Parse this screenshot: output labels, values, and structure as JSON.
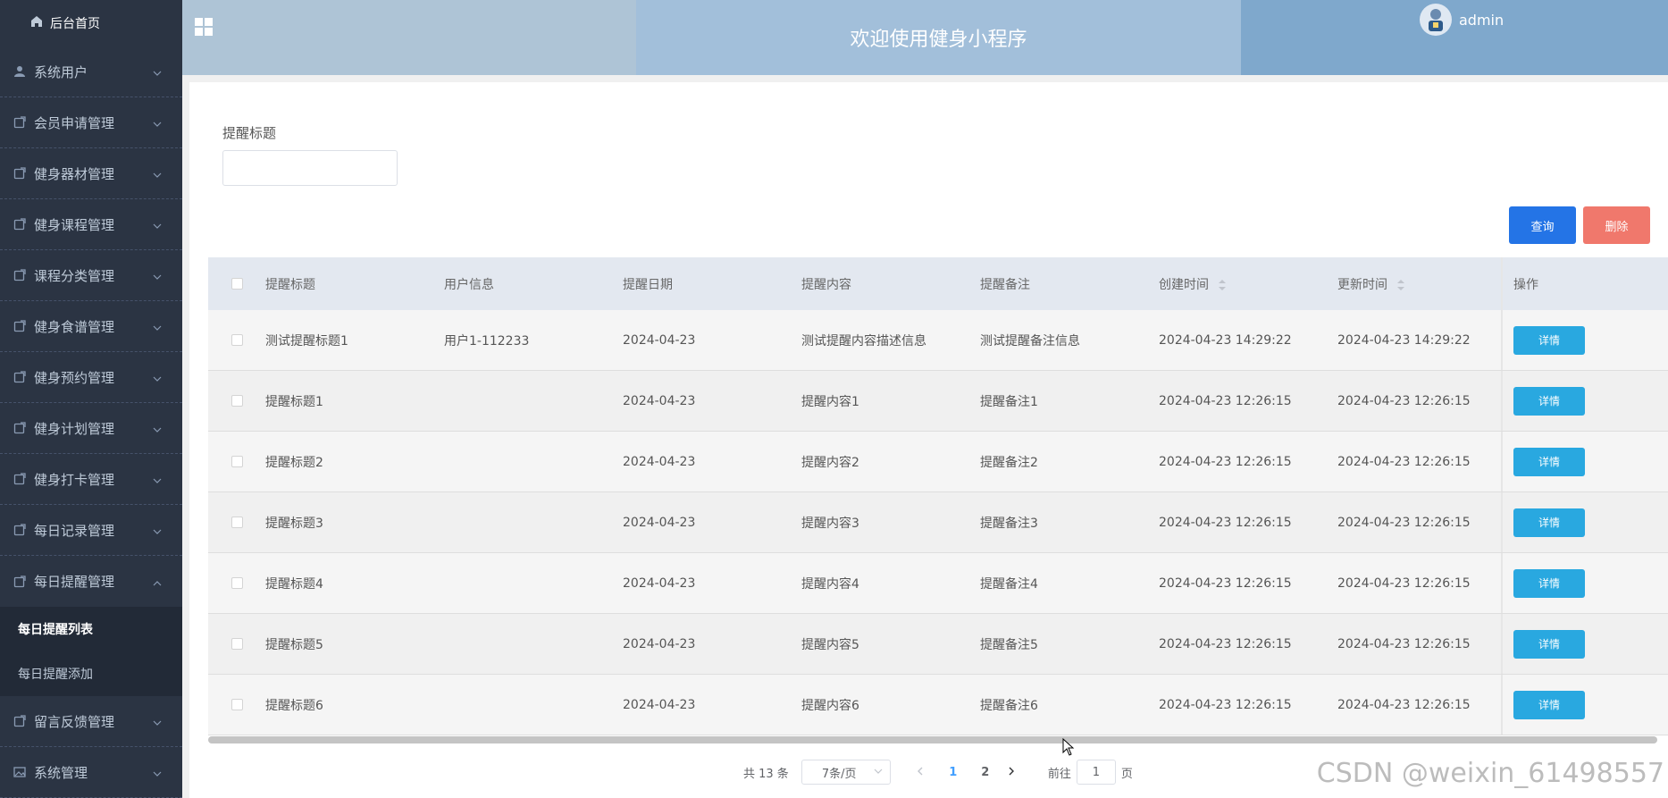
{
  "sidebar": {
    "home_label": "后台首页",
    "items": [
      {
        "label": "系统用户",
        "icon": "user-icon"
      },
      {
        "label": "会员申请管理",
        "icon": "doc-icon"
      },
      {
        "label": "健身器材管理",
        "icon": "doc-icon"
      },
      {
        "label": "健身课程管理",
        "icon": "doc-icon"
      },
      {
        "label": "课程分类管理",
        "icon": "doc-icon"
      },
      {
        "label": "健身食谱管理",
        "icon": "doc-icon"
      },
      {
        "label": "健身预约管理",
        "icon": "doc-icon"
      },
      {
        "label": "健身计划管理",
        "icon": "doc-icon"
      },
      {
        "label": "健身打卡管理",
        "icon": "doc-icon"
      },
      {
        "label": "每日记录管理",
        "icon": "doc-icon"
      },
      {
        "label": "每日提醒管理",
        "icon": "doc-icon"
      }
    ],
    "submenu": [
      "每日提醒列表",
      "每日提醒添加"
    ],
    "items_after": [
      {
        "label": "留言反馈管理",
        "icon": "doc-icon"
      },
      {
        "label": "系统管理",
        "icon": "image-icon"
      }
    ]
  },
  "header": {
    "title": "欢迎使用健身小程序",
    "username": "admin"
  },
  "search": {
    "label": "提醒标题",
    "value": "",
    "query_label": "查询",
    "delete_label": "删除"
  },
  "table": {
    "columns": [
      "提醒标题",
      "用户信息",
      "提醒日期",
      "提醒内容",
      "提醒备注",
      "创建时间",
      "更新时间",
      "操作"
    ],
    "rows": [
      [
        "测试提醒标题1",
        "用户1-112233",
        "2024-04-23",
        "测试提醒内容描述信息",
        "测试提醒备注信息",
        "2024-04-23 14:29:22",
        "2024-04-23 14:29:22"
      ],
      [
        "提醒标题1",
        "",
        "2024-04-23",
        "提醒内容1",
        "提醒备注1",
        "2024-04-23 12:26:15",
        "2024-04-23 12:26:15"
      ],
      [
        "提醒标题2",
        "",
        "2024-04-23",
        "提醒内容2",
        "提醒备注2",
        "2024-04-23 12:26:15",
        "2024-04-23 12:26:15"
      ],
      [
        "提醒标题3",
        "",
        "2024-04-23",
        "提醒内容3",
        "提醒备注3",
        "2024-04-23 12:26:15",
        "2024-04-23 12:26:15"
      ],
      [
        "提醒标题4",
        "",
        "2024-04-23",
        "提醒内容4",
        "提醒备注4",
        "2024-04-23 12:26:15",
        "2024-04-23 12:26:15"
      ],
      [
        "提醒标题5",
        "",
        "2024-04-23",
        "提醒内容5",
        "提醒备注5",
        "2024-04-23 12:26:15",
        "2024-04-23 12:26:15"
      ],
      [
        "提醒标题6",
        "",
        "2024-04-23",
        "提醒内容6",
        "提醒备注6",
        "2024-04-23 12:26:15",
        "2024-04-23 12:26:15"
      ]
    ],
    "detail_label": "详情"
  },
  "pagination": {
    "total": "共 13 条",
    "page_size": "7条/页",
    "pages": [
      "1",
      "2"
    ],
    "current": "1",
    "goto_prefix": "前往",
    "goto_value": "1",
    "goto_suffix": "页"
  },
  "watermark": "CSDN @weixin_61498557",
  "colors": {
    "sidebar_bg": "#2b3443",
    "query_button": "#2474e6",
    "delete_button": "#f0786c",
    "detail_button": "#29a8e0",
    "active_page": "#409eff"
  }
}
